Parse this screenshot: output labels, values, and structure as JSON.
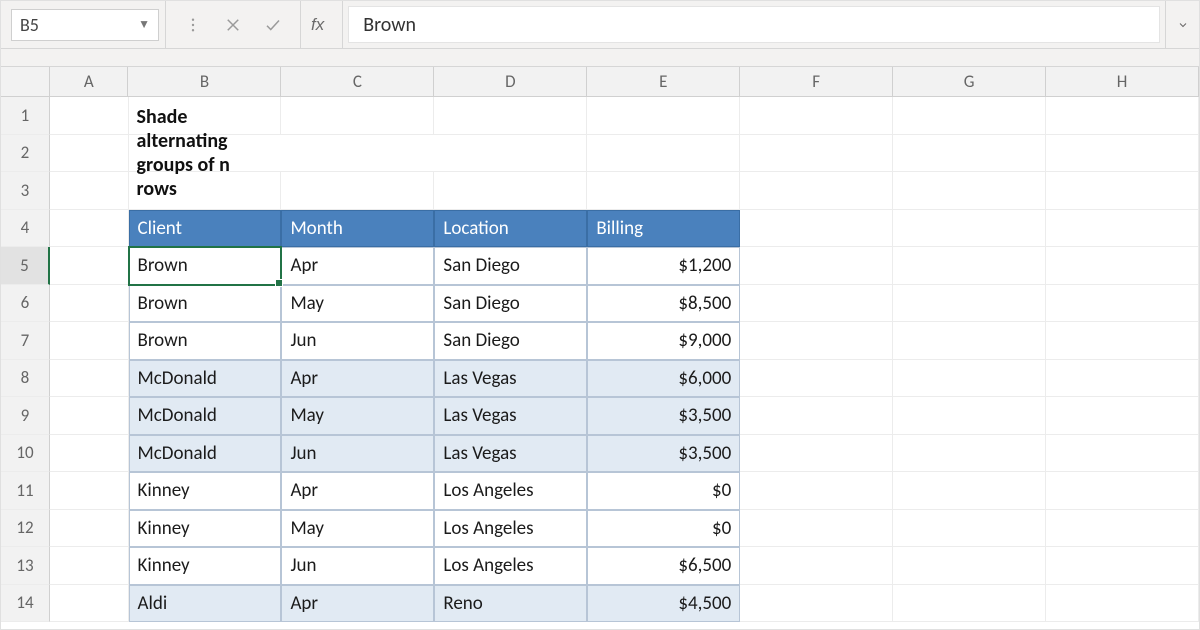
{
  "formula_bar": {
    "cell_ref": "B5",
    "fx_label": "fx",
    "value": "Brown"
  },
  "columns": [
    "A",
    "B",
    "C",
    "D",
    "E",
    "F",
    "G",
    "H"
  ],
  "row_labels": [
    "1",
    "2",
    "3",
    "4",
    "5",
    "6",
    "7",
    "8",
    "9",
    "10",
    "11",
    "12",
    "13",
    "14"
  ],
  "title": "Shade alternating groups of n rows",
  "table": {
    "headers": [
      "Client",
      "Month",
      "Location",
      "Billing"
    ],
    "rows": [
      {
        "client": "Brown",
        "month": "Apr",
        "location": "San Diego",
        "billing": "$1,200",
        "shade": false
      },
      {
        "client": "Brown",
        "month": "May",
        "location": "San Diego",
        "billing": "$8,500",
        "shade": false
      },
      {
        "client": "Brown",
        "month": "Jun",
        "location": "San Diego",
        "billing": "$9,000",
        "shade": false
      },
      {
        "client": "McDonald",
        "month": "Apr",
        "location": "Las Vegas",
        "billing": "$6,000",
        "shade": true
      },
      {
        "client": "McDonald",
        "month": "May",
        "location": "Las Vegas",
        "billing": "$3,500",
        "shade": true
      },
      {
        "client": "McDonald",
        "month": "Jun",
        "location": "Las Vegas",
        "billing": "$3,500",
        "shade": true
      },
      {
        "client": "Kinney",
        "month": "Apr",
        "location": "Los Angeles",
        "billing": "$0",
        "shade": false
      },
      {
        "client": "Kinney",
        "month": "May",
        "location": "Los Angeles",
        "billing": "$0",
        "shade": false
      },
      {
        "client": "Kinney",
        "month": "Jun",
        "location": "Los Angeles",
        "billing": "$6,500",
        "shade": false
      },
      {
        "client": "Aldi",
        "month": "Apr",
        "location": "Reno",
        "billing": "$4,500",
        "shade": true
      }
    ]
  },
  "selected_cell": "B5",
  "colors": {
    "header_bg": "#4a81bd",
    "shade_bg": "#e1eaf3",
    "selection": "#217346"
  }
}
